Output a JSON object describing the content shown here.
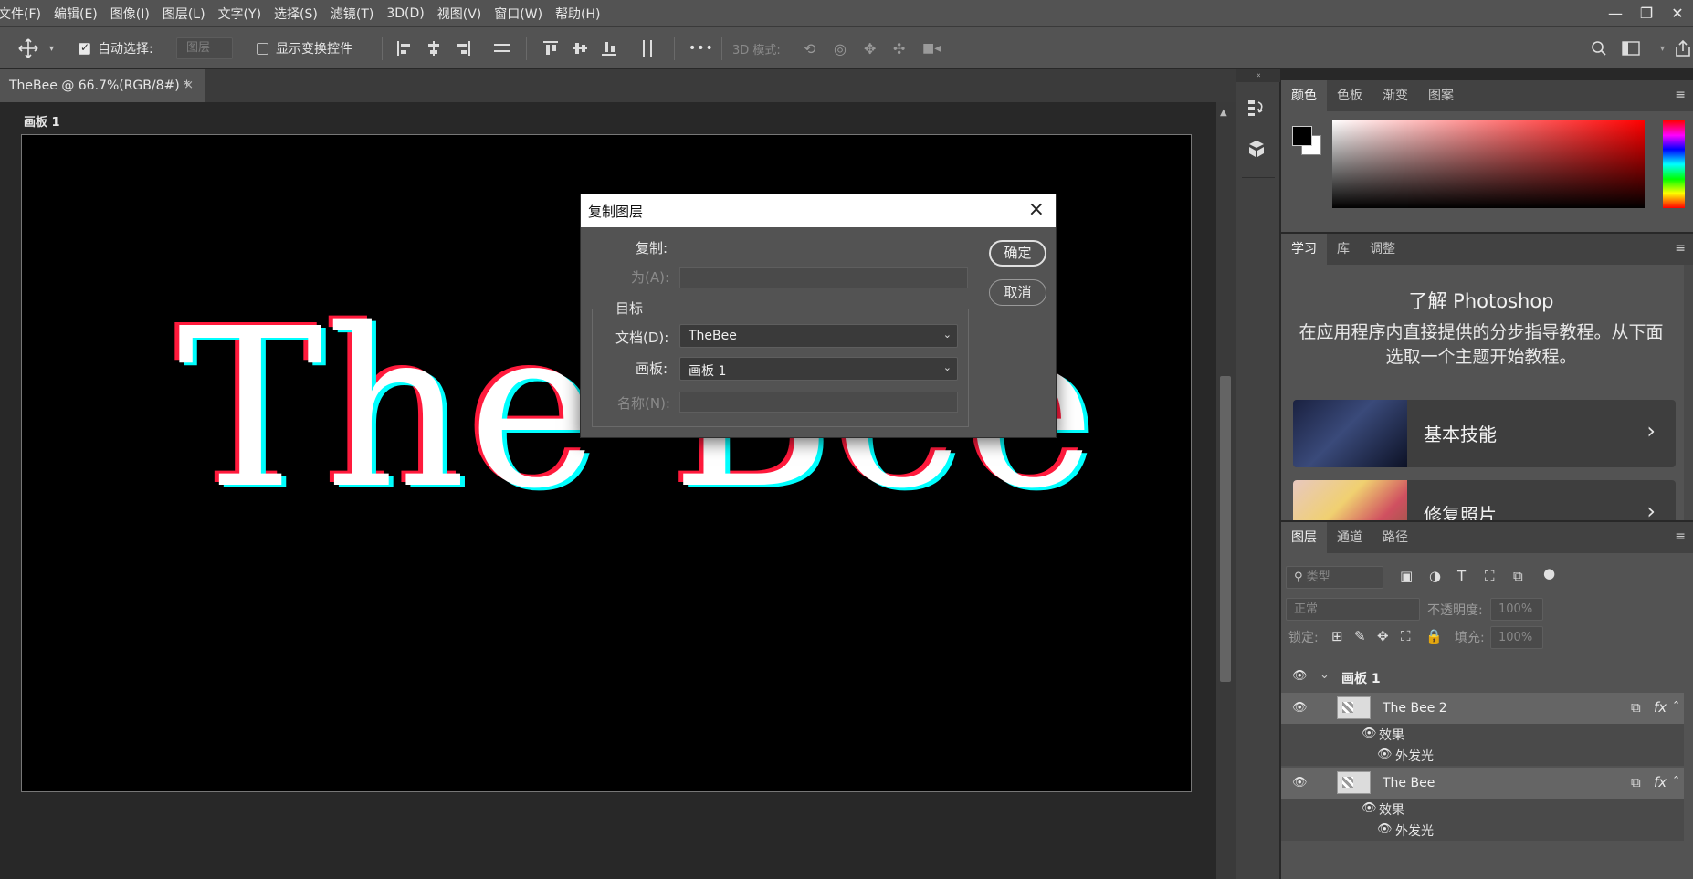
{
  "menu": [
    "文件(F)",
    "编辑(E)",
    "图像(I)",
    "图层(L)",
    "文字(Y)",
    "选择(S)",
    "滤镜(T)",
    "3D(D)",
    "视图(V)",
    "窗口(W)",
    "帮助(H)"
  ],
  "window_controls": {
    "minimize": "—",
    "restore": "❐",
    "close": "✕"
  },
  "options": {
    "auto_select_label": "自动选择:",
    "auto_select_checked": true,
    "auto_select_target": "图层",
    "show_transform_label": "显示变换控件",
    "show_transform_checked": false,
    "more_label": "•••",
    "mode_3d_label": "3D 模式:"
  },
  "document_tab": {
    "title": "TheBee @ 66.7%(RGB/8#) *",
    "close": "×"
  },
  "canvas": {
    "artboard_label": "画板 1",
    "text": "The Bee",
    "colors": {
      "background": "#000000",
      "fill": "#ffffff",
      "red_offset": "#ff1a3c",
      "cyan_offset": "#00ffff"
    }
  },
  "dialog": {
    "title": "复制图层",
    "copy_label": "复制:",
    "as_label": "为(A):",
    "as_value": "",
    "target_group": "目标",
    "document_label": "文档(D):",
    "document_value": "TheBee",
    "artboard_label": "画板:",
    "artboard_value": "画板 1",
    "name_label": "名称(N):",
    "name_value": "",
    "ok_label": "确定",
    "cancel_label": "取消"
  },
  "color_panel": {
    "tabs": [
      "颜色",
      "色板",
      "渐变",
      "图案"
    ],
    "foreground": "#000000",
    "background": "#ffffff",
    "hue": "#ff0000"
  },
  "learn_panel": {
    "tabs": [
      "学习",
      "库",
      "调整"
    ],
    "title": "了解 Photoshop",
    "description": "在应用程序内直接提供的分步指导教程。从下面选取一个主题开始教程。",
    "cards": [
      {
        "label": "基本技能",
        "chevron": "›"
      },
      {
        "label": "修复照片",
        "chevron": "›"
      }
    ]
  },
  "layers_panel": {
    "tabs": [
      "图层",
      "通道",
      "路径"
    ],
    "filter_placeholder": "类型",
    "blend_mode": "正常",
    "opacity_label": "不透明度:",
    "opacity_value": "100%",
    "lock_label": "锁定:",
    "fill_label": "填充:",
    "fill_value": "100%",
    "group_name": "画板 1",
    "layers": [
      {
        "name": "The Bee 2",
        "effects_label": "效果",
        "effect": "外发光",
        "fx": "fx"
      },
      {
        "name": "The Bee",
        "effects_label": "效果",
        "effect": "外发光",
        "fx": "fx"
      }
    ]
  }
}
